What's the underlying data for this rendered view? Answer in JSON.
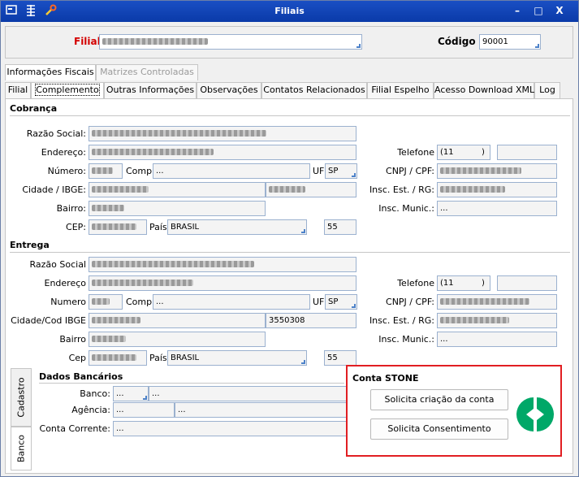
{
  "window": {
    "title": "Filiais",
    "minimize": "–",
    "maximize": "□",
    "close": "X"
  },
  "header": {
    "filial_label": "Filial",
    "codigo_label": "Código",
    "codigo_value": "90001"
  },
  "outer_tabs": [
    "Informações Fiscais",
    "Matrizes Controladas"
  ],
  "inner_tabs": [
    "Filial",
    "Complemento",
    "Outras Informações",
    "Observações",
    "Contatos Relacionados",
    "Filial Espelho",
    "Acesso Download XML",
    "Log"
  ],
  "cobranca": {
    "title": "Cobrança",
    "razao_social_label": "Razão Social:",
    "endereco_label": "Endereço:",
    "numero_label": "Número:",
    "compl_label": "Compl.",
    "compl_value": "...",
    "uf_label": "UF",
    "uf_value": "SP",
    "cidade_label": "Cidade / IBGE:",
    "bairro_label": "Bairro:",
    "cep_label": "CEP:",
    "pais_label": "País",
    "pais_value": "BRASIL",
    "pais_code": "55",
    "telefone_label": "Telefone",
    "telefone_ddd": "(11",
    "telefone_close": ")",
    "cnpj_label": "CNPJ / CPF:",
    "insc_est_label": "Insc. Est. / RG:",
    "insc_munic_label": "Insc. Munic.:",
    "insc_munic_value": "..."
  },
  "entrega": {
    "title": "Entrega",
    "razao_social_label": "Razão Social",
    "endereco_label": "Endereço",
    "numero_label": "Numero",
    "compl_label": "Compl.",
    "compl_value": "...",
    "uf_label": "UF",
    "uf_value": "SP",
    "cidade_label": "Cidade/Cod IBGE",
    "ibge_value": "3550308",
    "bairro_label": "Bairro",
    "cep_label": "Cep",
    "pais_label": "País",
    "pais_value": "BRASIL",
    "pais_code": "55",
    "telefone_label": "Telefone",
    "telefone_ddd": "(11",
    "telefone_close": ")",
    "cnpj_label": "CNPJ / CPF:",
    "insc_est_label": "Insc. Est. / RG:",
    "insc_munic_label": "Insc. Munic.:",
    "insc_munic_value": "..."
  },
  "side_tabs": [
    "Cadastro",
    "Banco"
  ],
  "dados_bancarios": {
    "title": "Dados Bancários",
    "banco_label": "Banco:",
    "banco_value": "...",
    "banco_value2": "...",
    "agencia_label": "Agência:",
    "agencia_value": "...",
    "agencia_value2": "...",
    "conta_label": "Conta Corrente:",
    "conta_value": "..."
  },
  "conta_stone": {
    "title": "Conta STONE",
    "btn_criacao": "Solicita criação da conta",
    "btn_consentimento": "Solicita Consentimento",
    "logo_color": "#00a868",
    "highlight_color": "#e11e22"
  }
}
